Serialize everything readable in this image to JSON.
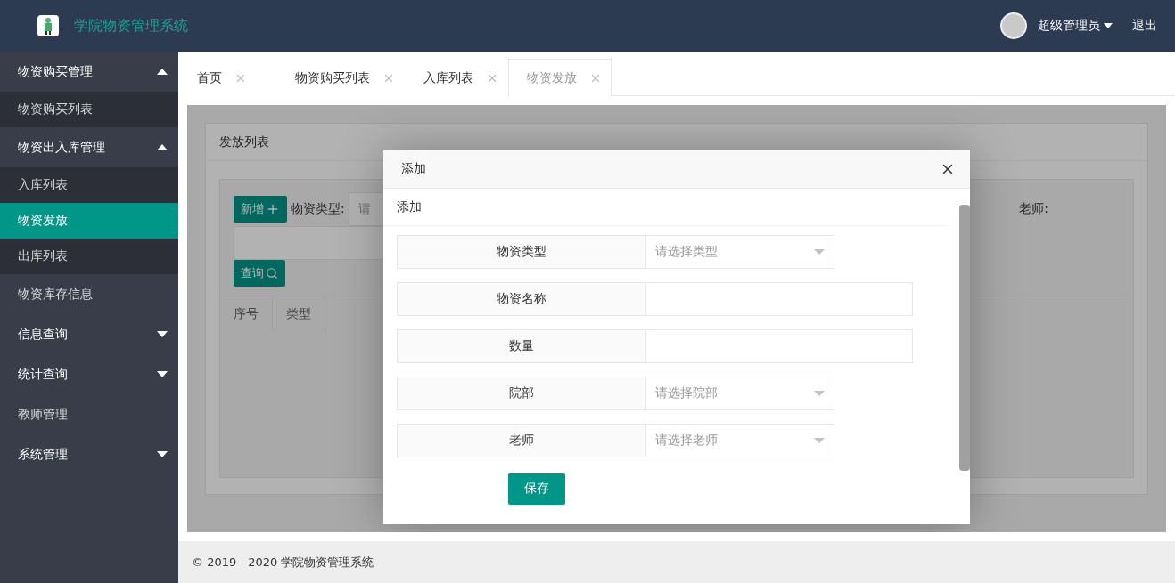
{
  "header": {
    "title": "学院物资管理系统",
    "user": "超级管理员",
    "logout": "退出"
  },
  "sidebar": {
    "items": [
      {
        "kind": "group",
        "label": "物资购买管理",
        "expanded": true,
        "children": [
          {
            "label": "物资购买列表",
            "selected": false
          }
        ]
      },
      {
        "kind": "group",
        "label": "物资出入库管理",
        "expanded": true,
        "children": [
          {
            "label": "入库列表",
            "selected": false
          },
          {
            "label": "物资发放",
            "selected": true
          },
          {
            "label": "出库列表",
            "selected": false
          }
        ]
      },
      {
        "kind": "link",
        "label": "物资库存信息",
        "selected": false
      },
      {
        "kind": "group",
        "label": "信息查询",
        "expanded": false
      },
      {
        "kind": "group",
        "label": "统计查询",
        "expanded": false
      },
      {
        "kind": "link",
        "label": "教师管理",
        "selected": false
      },
      {
        "kind": "group",
        "label": "系统管理",
        "expanded": false
      }
    ]
  },
  "tabs": [
    {
      "label": "首页",
      "selected": false
    },
    {
      "label": "物资购买列表",
      "selected": false
    },
    {
      "label": "入库列表",
      "selected": false
    },
    {
      "label": "物资发放",
      "selected": true
    }
  ],
  "panel": {
    "title": "发放列表",
    "add_button": "新增",
    "type_label": "物资类型:",
    "type_placeholder": "请",
    "teacher_label": "老师:",
    "query_button": "查询",
    "columns": [
      "序号",
      "类型"
    ]
  },
  "dialog": {
    "title": "添加",
    "section": "添加",
    "fields": [
      {
        "kind": "select",
        "label": "物资类型",
        "placeholder": "请选择类型"
      },
      {
        "kind": "text",
        "label": "物资名称"
      },
      {
        "kind": "text",
        "label": "数量"
      },
      {
        "kind": "select",
        "label": "院部",
        "placeholder": "请选择院部"
      },
      {
        "kind": "select",
        "label": "老师",
        "placeholder": "请选择老师"
      }
    ],
    "save": "保存"
  },
  "footer": "© 2019 - 2020 学院物资管理系统"
}
